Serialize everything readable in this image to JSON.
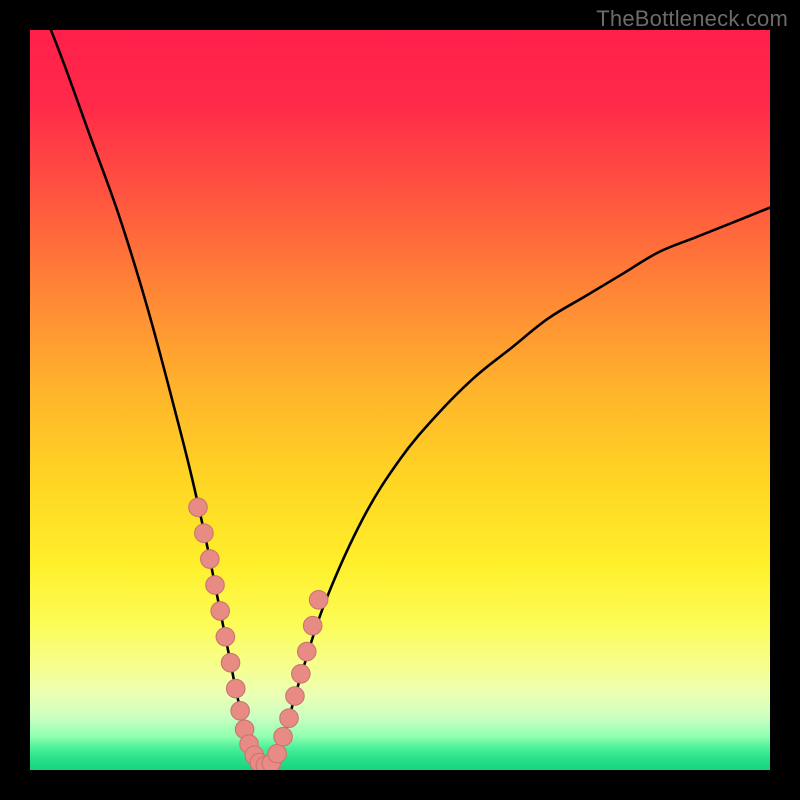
{
  "watermark": "TheBottleneck.com",
  "colors": {
    "frame": "#000000",
    "curve": "#000000",
    "dot_fill": "#e98b85",
    "dot_stroke": "#c97570"
  },
  "gradient_stops": [
    {
      "pct": 0,
      "color": "#ff1f4b"
    },
    {
      "pct": 10,
      "color": "#ff2a49"
    },
    {
      "pct": 22,
      "color": "#ff5340"
    },
    {
      "pct": 35,
      "color": "#ff8436"
    },
    {
      "pct": 48,
      "color": "#ffb22c"
    },
    {
      "pct": 60,
      "color": "#ffd323"
    },
    {
      "pct": 72,
      "color": "#ffef2a"
    },
    {
      "pct": 80,
      "color": "#fcfc55"
    },
    {
      "pct": 86,
      "color": "#f6ff8e"
    },
    {
      "pct": 90,
      "color": "#eaffb5"
    },
    {
      "pct": 93,
      "color": "#c9ffc0"
    },
    {
      "pct": 95.5,
      "color": "#8effb0"
    },
    {
      "pct": 97,
      "color": "#4cf09a"
    },
    {
      "pct": 98.5,
      "color": "#28e08a"
    },
    {
      "pct": 100,
      "color": "#18d47e"
    }
  ],
  "chart_data": {
    "type": "line",
    "title": "",
    "xlabel": "",
    "ylabel": "",
    "xlim": [
      0,
      100
    ],
    "ylim": [
      0,
      100
    ],
    "series": [
      {
        "name": "bottleneck-curve",
        "x": [
          0,
          4,
          8,
          12,
          16,
          20,
          22,
          24,
          25,
          26,
          27,
          28,
          29,
          30,
          31,
          32,
          33,
          34,
          35,
          37,
          40,
          45,
          50,
          55,
          60,
          65,
          70,
          75,
          80,
          85,
          90,
          95,
          100
        ],
        "values": [
          107,
          97,
          86,
          75,
          62,
          47,
          39,
          30,
          25,
          20,
          15,
          10,
          6,
          3,
          1,
          0.5,
          1,
          3,
          7,
          14,
          23,
          34,
          42,
          48,
          53,
          57,
          61,
          64,
          67,
          70,
          72,
          74,
          76
        ]
      }
    ],
    "highlight_points": {
      "name": "highlighted-region",
      "x": [
        22.7,
        23.5,
        24.3,
        25.0,
        25.7,
        26.4,
        27.1,
        27.8,
        28.4,
        29.0,
        29.6,
        30.3,
        31.0,
        31.8,
        32.6,
        33.4,
        34.2,
        35.0,
        35.8,
        36.6,
        37.4,
        38.2,
        39.0
      ],
      "values": [
        35.5,
        32.0,
        28.5,
        25.0,
        21.5,
        18.0,
        14.5,
        11.0,
        8.0,
        5.5,
        3.5,
        2.0,
        1.0,
        0.6,
        0.9,
        2.2,
        4.5,
        7.0,
        10.0,
        13.0,
        16.0,
        19.5,
        23.0
      ]
    }
  }
}
